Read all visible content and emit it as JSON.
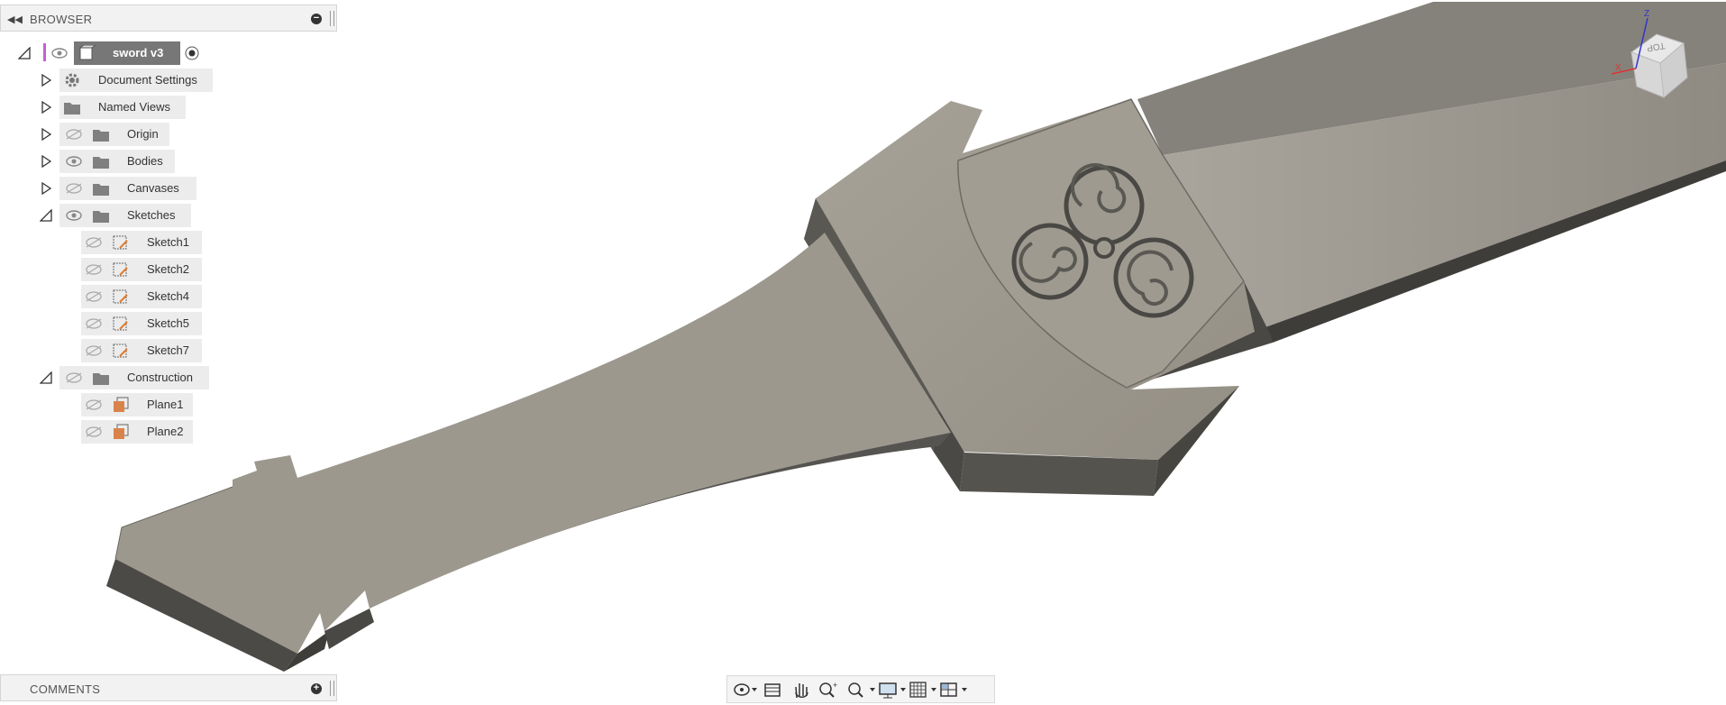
{
  "browser": {
    "title": "BROWSER",
    "root": {
      "label": "sword v3"
    },
    "items": [
      {
        "label": "Document Settings"
      },
      {
        "label": "Named Views"
      },
      {
        "label": "Origin"
      },
      {
        "label": "Bodies"
      },
      {
        "label": "Canvases"
      },
      {
        "label": "Sketches"
      },
      {
        "label": "Sketch1"
      },
      {
        "label": "Sketch2"
      },
      {
        "label": "Sketch4"
      },
      {
        "label": "Sketch5"
      },
      {
        "label": "Sketch7"
      },
      {
        "label": "Construction"
      },
      {
        "label": "Plane1"
      },
      {
        "label": "Plane2"
      }
    ]
  },
  "comments": {
    "title": "COMMENTS"
  },
  "viewcube": {
    "face_label": "TOP",
    "x_axis": "X",
    "z_axis": "Z"
  },
  "toolbar": {
    "icons": [
      "orbit-icon",
      "look-at-icon",
      "pan-icon",
      "zoom-window-icon",
      "zoom-icon",
      "display-settings-icon",
      "grid-icon",
      "viewports-icon"
    ]
  },
  "colors": {
    "model_face": "#9b978f",
    "model_side": "#5d5b56",
    "panel_bg": "#f2f2f2",
    "accent": "#d9834a"
  }
}
